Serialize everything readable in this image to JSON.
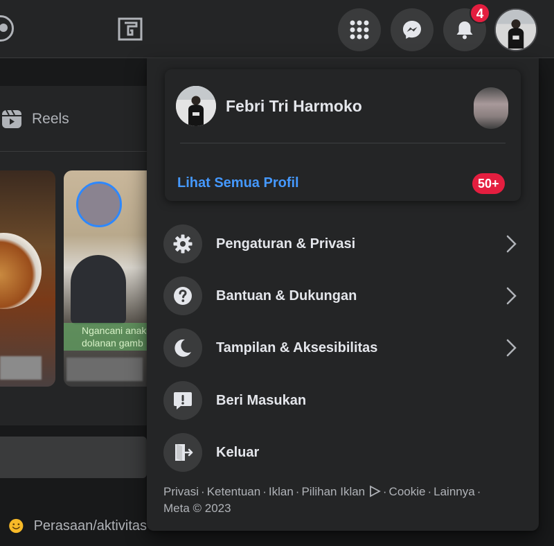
{
  "notifications": {
    "count": "4"
  },
  "nav": {
    "reels_label": "Reels",
    "feeling_label": "Perasaan/aktivitas",
    "story_caption": "Ngancani anak l\ndolanan gamb"
  },
  "account_menu": {
    "profile_name": "Febri Tri Harmoko",
    "see_all_profiles": "Lihat Semua Profil",
    "profiles_count": "50+",
    "items": [
      {
        "label": "Pengaturan & Privasi",
        "icon": "gear-icon",
        "has_submenu": true
      },
      {
        "label": "Bantuan & Dukungan",
        "icon": "help-icon",
        "has_submenu": true
      },
      {
        "label": "Tampilan & Aksesibilitas",
        "icon": "moon-icon",
        "has_submenu": true
      },
      {
        "label": "Beri Masukan",
        "icon": "feedback-icon",
        "has_submenu": false
      },
      {
        "label": "Keluar",
        "icon": "logout-icon",
        "has_submenu": false
      }
    ]
  },
  "footer": {
    "links": [
      "Privasi",
      "Ketentuan",
      "Iklan",
      "Pilihan Iklan",
      "Cookie",
      "Lainnya"
    ],
    "copyright": "Meta © 2023"
  },
  "colors": {
    "background": "#18191a",
    "surface": "#242526",
    "button": "#3a3b3c",
    "link_blue": "#4599ff",
    "badge_red": "#e41e3f"
  }
}
